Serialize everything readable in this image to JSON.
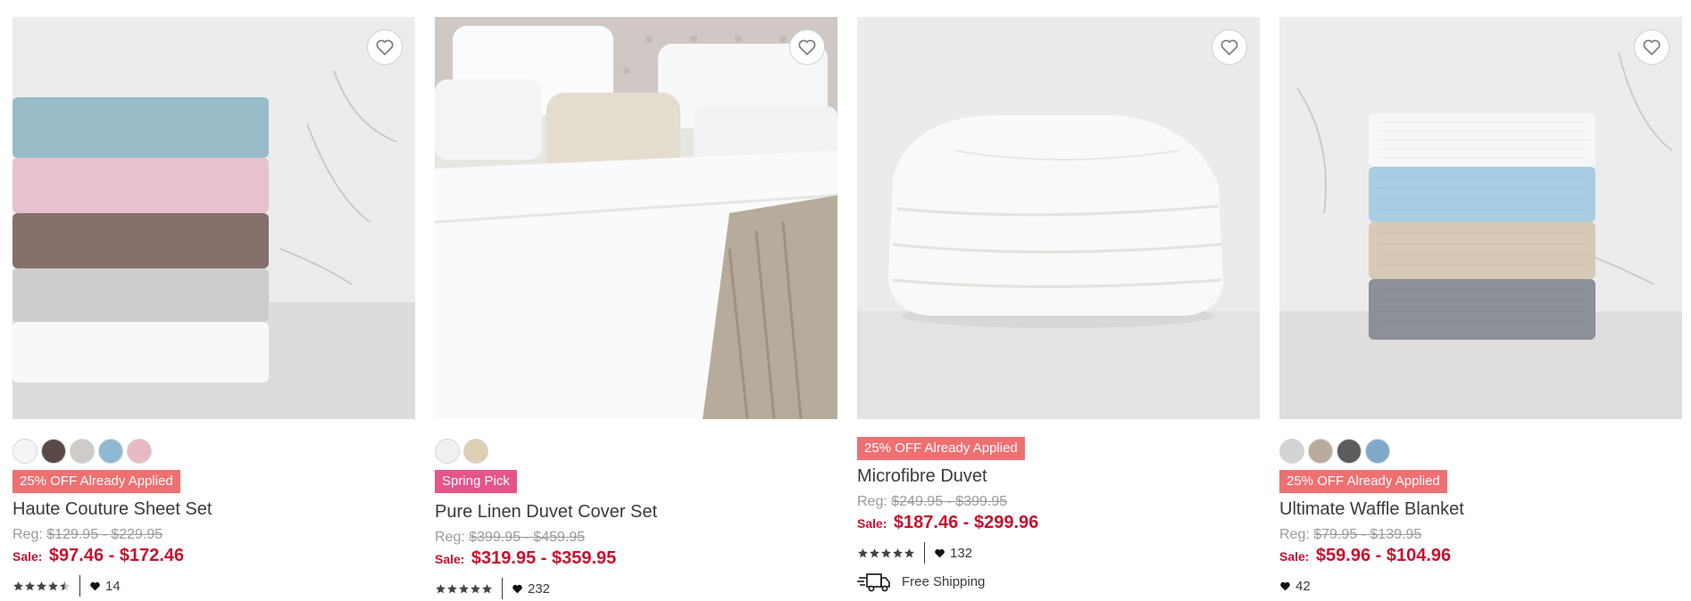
{
  "colors": {
    "sale_red": "#c8102e",
    "badge_coral": "#ee7072",
    "badge_pink": "#e6548a"
  },
  "products": [
    {
      "name": "Haute Couture Sheet Set",
      "badge": "25% OFF Already Applied",
      "swatches": [
        "#f4f4f6",
        "#5a4a47",
        "#cfcbc9",
        "#8fb8d3",
        "#e9b9c4"
      ],
      "reg_label": "Reg:",
      "reg_price": "$129.95 - $229.95",
      "sale_label": "Sale:",
      "sale_price": "$97.46 - $172.46",
      "rating": 4.5,
      "likes": "14",
      "image": "stacked sheets"
    },
    {
      "name": "Pure Linen Duvet Cover Set",
      "badge": "Spring Pick",
      "swatches": [
        "#f1f0ee",
        "#ddcfb2"
      ],
      "reg_label": "Reg:",
      "reg_price": "$399.95 - $459.95",
      "sale_label": "Sale:",
      "sale_price": "$319.95 - $359.95",
      "rating": 5,
      "likes": "232",
      "image": "made bed"
    },
    {
      "name": "Microfibre Duvet",
      "badge": "25% OFF Already Applied",
      "swatches": [],
      "reg_label": "Reg:",
      "reg_price": "$249.95 - $399.95",
      "sale_label": "Sale:",
      "sale_price": "$187.46 - $299.96",
      "rating": 5,
      "likes": "132",
      "shipping": "Free Shipping",
      "image": "folded duvet"
    },
    {
      "name": "Ultimate Waffle Blanket",
      "badge": "25% OFF Already Applied",
      "swatches": [
        "#d3d3d3",
        "#b9ab9b",
        "#5c5c5e",
        "#7fa9c8"
      ],
      "reg_label": "Reg:",
      "reg_price": "$79.95 - $139.95",
      "sale_label": "Sale:",
      "sale_price": "$59.96 - $104.96",
      "likes": "42",
      "image": "stacked blankets"
    }
  ]
}
